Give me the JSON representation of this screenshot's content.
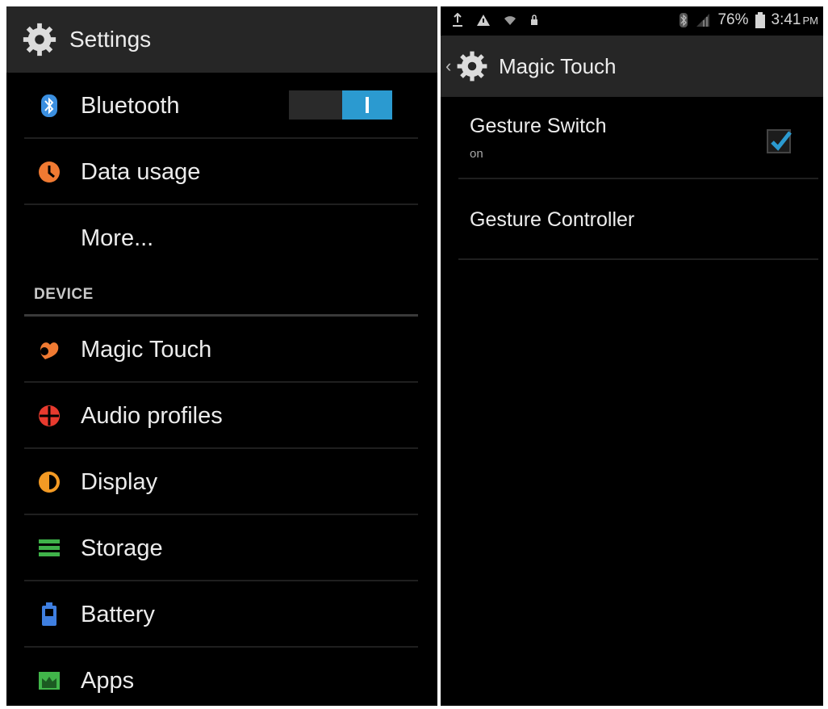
{
  "left": {
    "header": {
      "title": "Settings",
      "icon": "gear-icon"
    },
    "items_top": [
      {
        "label": "Bluetooth",
        "icon": "bluetooth-icon",
        "toggle": true
      },
      {
        "label": "Data usage",
        "icon": "data-usage-icon"
      },
      {
        "label": "More...",
        "icon": ""
      }
    ],
    "section": "DEVICE",
    "items_device": [
      {
        "label": "Magic Touch",
        "icon": "magic-touch-icon"
      },
      {
        "label": "Audio profiles",
        "icon": "audio-profiles-icon"
      },
      {
        "label": "Display",
        "icon": "display-icon"
      },
      {
        "label": "Storage",
        "icon": "storage-icon"
      },
      {
        "label": "Battery",
        "icon": "battery-icon"
      },
      {
        "label": "Apps",
        "icon": "apps-icon"
      }
    ]
  },
  "right": {
    "status_bar": {
      "battery_percent": "76%",
      "time": "3:41",
      "ampm": "PM"
    },
    "header": {
      "title": "Magic Touch",
      "icon": "gear-icon"
    },
    "prefs": [
      {
        "title": "Gesture Switch",
        "summary": "on",
        "checked": true
      },
      {
        "title": "Gesture Controller"
      }
    ]
  },
  "colors": {
    "accent": "#2b9ad0",
    "bluetooth": "#3b8fe0",
    "data_usage": "#f07a32",
    "magic_touch": "#f07a32",
    "audio": "#e83a2e",
    "display": "#f39a24",
    "storage": "#3fb24a",
    "battery": "#3f7fe0",
    "apps": "#41b54a"
  }
}
